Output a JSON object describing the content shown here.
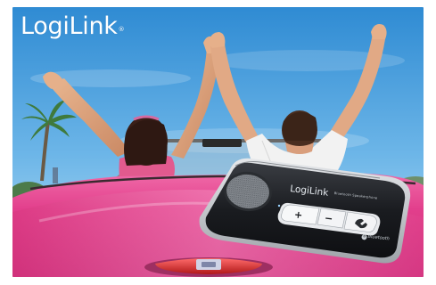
{
  "brand": {
    "logo_main": "LogiLink",
    "logo_reg": "®"
  },
  "device": {
    "brand_label": "LogiLink",
    "model_label": "Bluetooth Speakerphone",
    "bluetooth_label": "Bluetooth",
    "buttons": [
      "+",
      "−",
      "phone"
    ]
  },
  "colors": {
    "sky_top": "#3d95d8",
    "sky_bottom": "#a8d7f2",
    "car_pink": "#e8418f",
    "device_body": "#1c1e22",
    "device_rim": "#c9ccd0"
  }
}
